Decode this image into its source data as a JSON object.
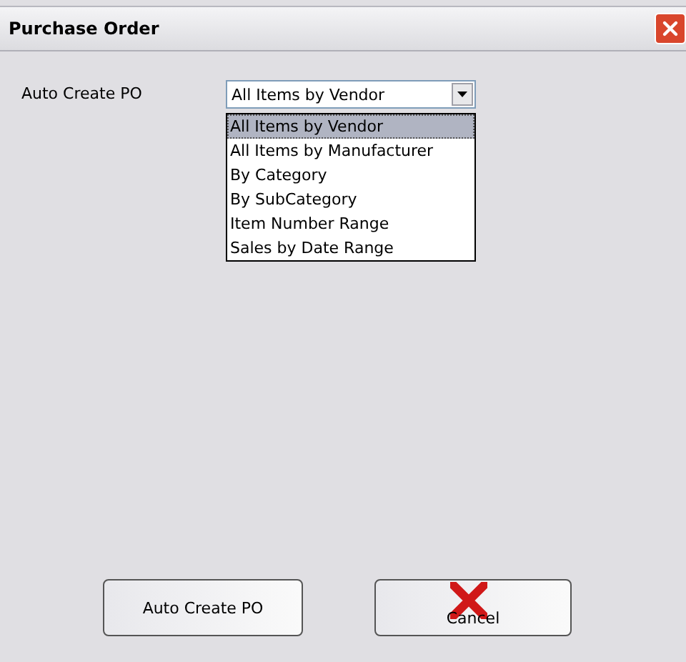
{
  "window": {
    "title": "Purchase Order"
  },
  "field": {
    "label": "Auto Create PO",
    "value": "All Items by Vendor",
    "expanded": true
  },
  "options": [
    {
      "label": "All Items by Vendor",
      "selected": true
    },
    {
      "label": "All Items by Manufacturer",
      "selected": false
    },
    {
      "label": "By Category",
      "selected": false
    },
    {
      "label": "By SubCategory",
      "selected": false
    },
    {
      "label": "Item Number Range",
      "selected": false
    },
    {
      "label": "Sales by Date Range",
      "selected": false
    }
  ],
  "buttons": [
    {
      "label": "Auto Create PO",
      "kind": "plain"
    },
    {
      "label": "Cancel",
      "kind": "cancel"
    }
  ]
}
